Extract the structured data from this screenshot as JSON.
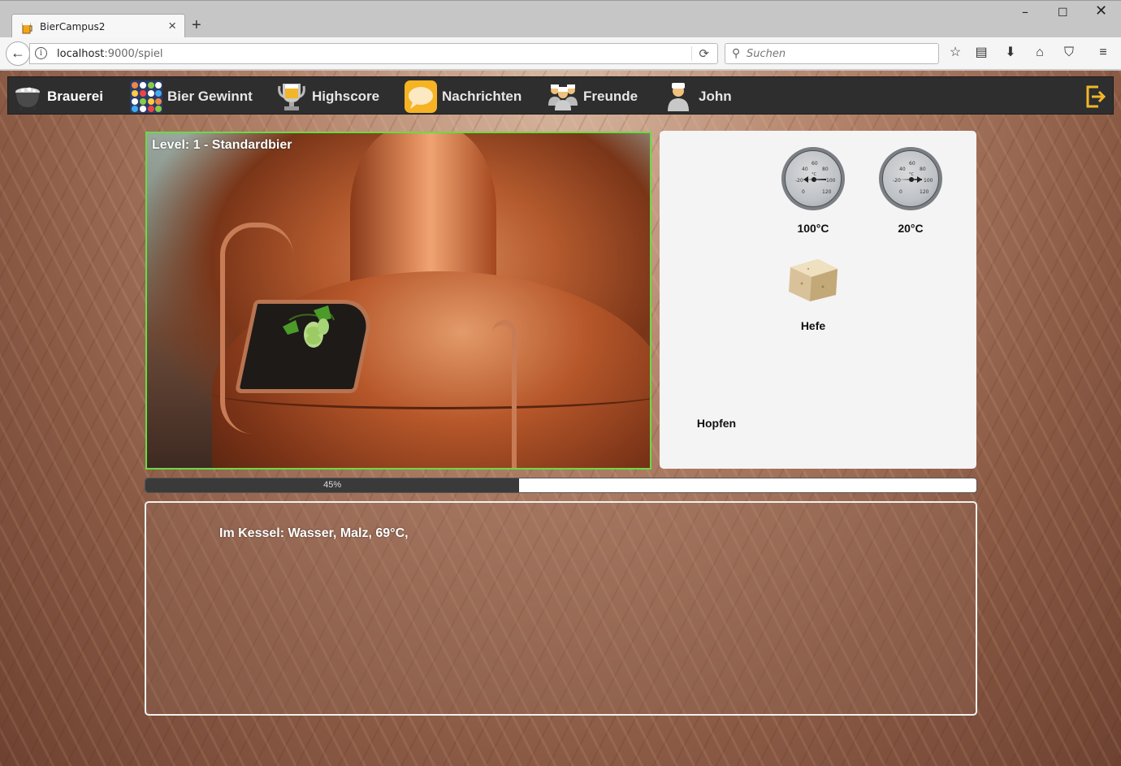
{
  "browser": {
    "tab_title": "BierCampus2",
    "url_host": "localhost",
    "url_rest": ":9000/spiel",
    "search_placeholder": "Suchen"
  },
  "nav": {
    "items": [
      {
        "label": "Brauerei",
        "icon": "brewing-kettle-icon"
      },
      {
        "label": "Bier Gewinnt",
        "icon": "bottle-grid-icon"
      },
      {
        "label": "Highscore",
        "icon": "trophy-icon"
      },
      {
        "label": "Nachrichten",
        "icon": "speech-bubble-icon"
      },
      {
        "label": "Freunde",
        "icon": "friends-icon"
      },
      {
        "label": "John",
        "icon": "user-icon"
      }
    ],
    "logout_icon": "logout-icon"
  },
  "game": {
    "level_label": "Level: 1 - Standardbier"
  },
  "tools": {
    "gauge1_label": "100°C",
    "gauge2_label": "20°C",
    "gauge_ticks": [
      "40",
      "60",
      "80",
      "-20",
      "100",
      "0",
      "120"
    ],
    "gauge_unit": "°C",
    "yeast_label": "Hefe",
    "hops_label": "Hopfen"
  },
  "progress": {
    "value": 45,
    "label": "45%"
  },
  "log": {
    "text": "Im Kessel: Wasser, Malz, 69°C,"
  },
  "colors": {
    "appbar": "#2e2e2e",
    "game_border": "#66dd44",
    "progress_fill": "#3a3a3a"
  }
}
